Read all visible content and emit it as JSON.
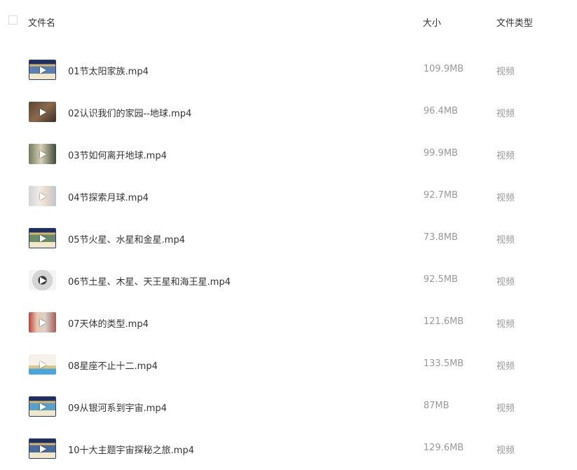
{
  "header": {
    "name_col": "文件名",
    "size_col": "大小",
    "type_col": "文件类型"
  },
  "files": [
    {
      "name": "01节太阳家族.mp4",
      "size": "109.9MB",
      "type": "视频",
      "thumb": "t1"
    },
    {
      "name": "02认识我们的家园--地球.mp4",
      "size": "96.4MB",
      "type": "视频",
      "thumb": "t2"
    },
    {
      "name": "03节如何离开地球.mp4",
      "size": "99.9MB",
      "type": "视频",
      "thumb": "t3"
    },
    {
      "name": "04节探索月球.mp4",
      "size": "92.7MB",
      "type": "视频",
      "thumb": "t4"
    },
    {
      "name": "05节火星、水星和金星.mp4",
      "size": "73.8MB",
      "type": "视频",
      "thumb": "t5"
    },
    {
      "name": "06节土星、木星、天王星和海王星.mp4",
      "size": "92.5MB",
      "type": "视频",
      "thumb": "t6"
    },
    {
      "name": "07天体的类型.mp4",
      "size": "121.6MB",
      "type": "视频",
      "thumb": "t7"
    },
    {
      "name": "08星座不止十二.mp4",
      "size": "133.5MB",
      "type": "视频",
      "thumb": "t8"
    },
    {
      "name": "09从银河系到宇宙.mp4",
      "size": "87MB",
      "type": "视频",
      "thumb": "t9"
    },
    {
      "name": "10十大主题宇宙探秘之旅.mp4",
      "size": "129.6MB",
      "type": "视频",
      "thumb": "t10"
    }
  ]
}
